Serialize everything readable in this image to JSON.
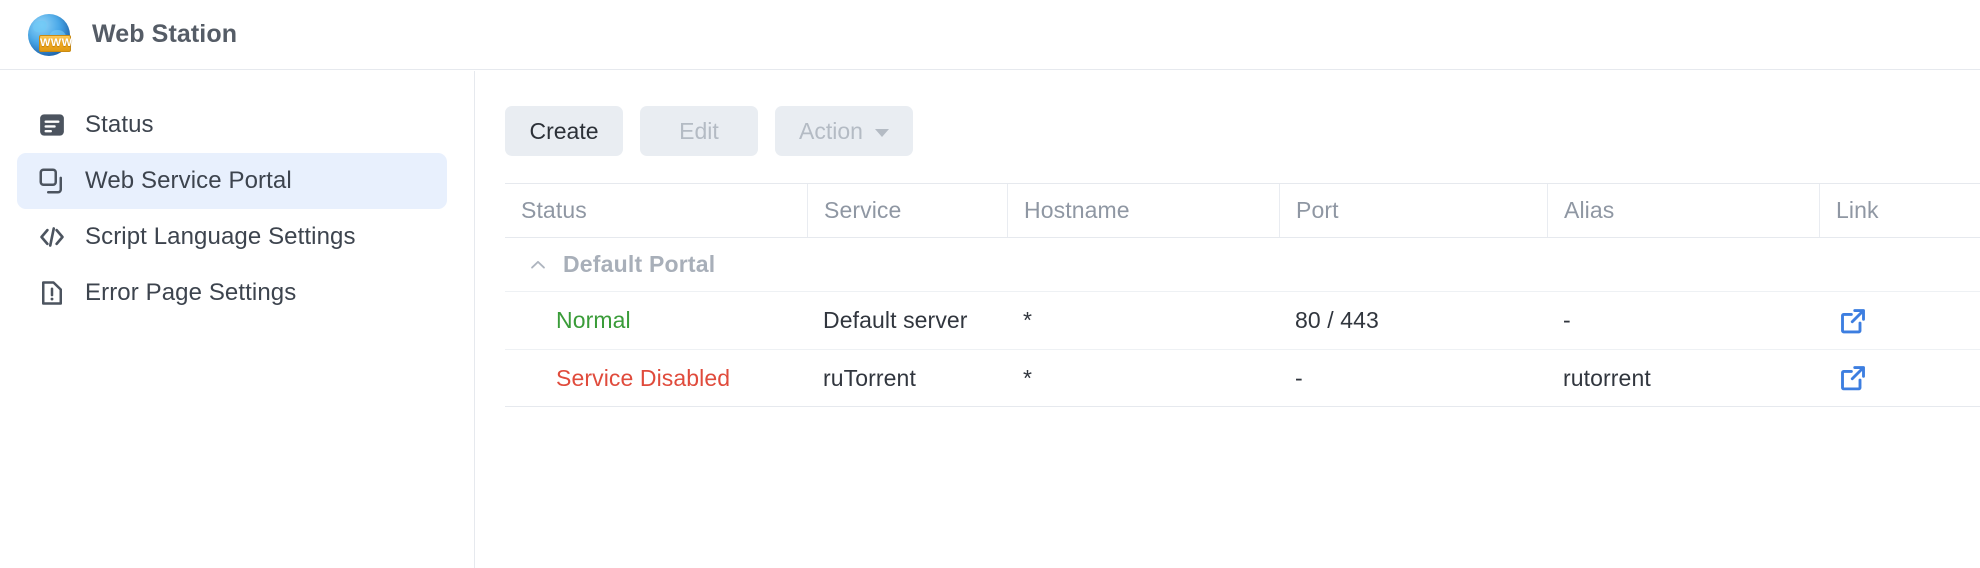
{
  "window": {
    "app_title": "Web Station",
    "logo_badge_text": "WWW",
    "logo_icon": "globe-www-icon"
  },
  "sidebar": {
    "items": [
      {
        "label": "Status",
        "icon": "status-list-icon",
        "selected": false
      },
      {
        "label": "Web Service Portal",
        "icon": "windows-stack-icon",
        "selected": true
      },
      {
        "label": "Script Language Settings",
        "icon": "code-brackets-icon",
        "selected": false
      },
      {
        "label": "Error Page Settings",
        "icon": "page-alert-icon",
        "selected": false
      }
    ]
  },
  "toolbar": {
    "create_label": "Create",
    "edit_label": "Edit",
    "action_label": "Action",
    "create_enabled": true,
    "edit_enabled": false,
    "action_enabled": false
  },
  "table": {
    "headers": [
      "Status",
      "Service",
      "Hostname",
      "Port",
      "Alias",
      "Link"
    ],
    "group": {
      "label": "Default Portal",
      "expanded": true,
      "chevron_icon": "chevron-up-icon"
    },
    "rows": [
      {
        "status": "Normal",
        "status_state": "normal",
        "service": "Default server",
        "hostname": "*",
        "port": "80 / 443",
        "alias": "-",
        "link_icon": "external-link-icon"
      },
      {
        "status": "Service Disabled",
        "status_state": "disabled",
        "service": "ruTorrent",
        "hostname": "*",
        "port": "-",
        "alias": "rutorrent",
        "link_icon": "external-link-icon"
      }
    ]
  },
  "colors": {
    "accent": "#3d7ee0",
    "selected_bg": "#e8f0fd",
    "status_normal": "#3a9c39",
    "status_disabled": "#e04b3c",
    "badge_gold": "#f0a81f"
  }
}
